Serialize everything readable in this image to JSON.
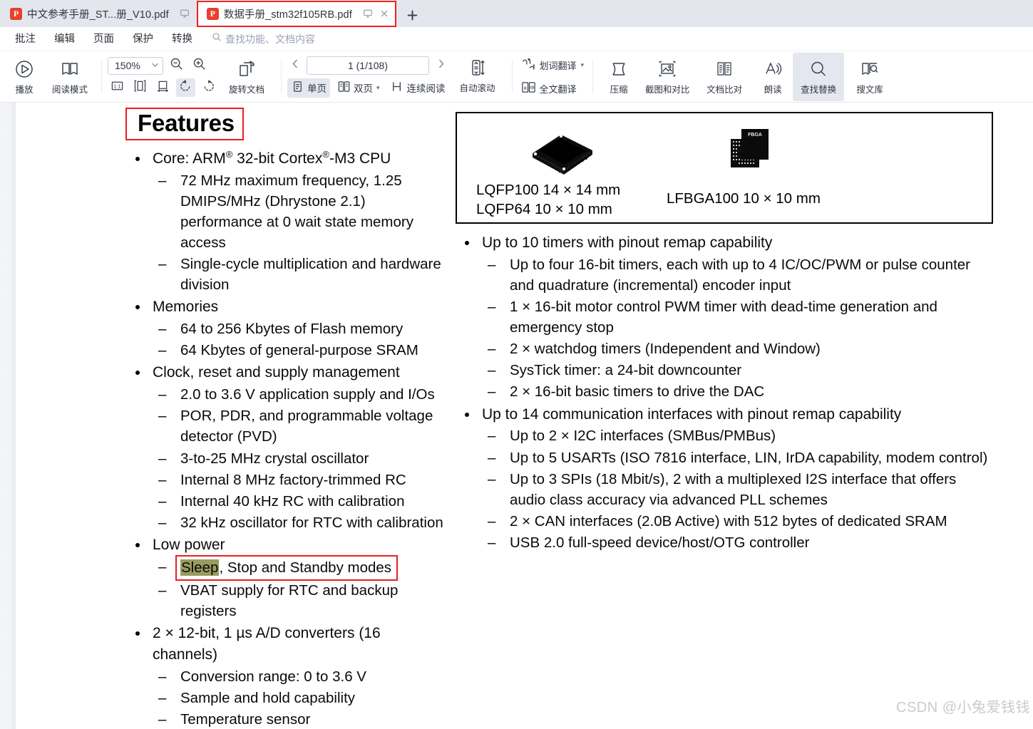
{
  "tabs": [
    {
      "label": "中文参考手册_ST...册_V10.pdf",
      "active": false,
      "badge": "P",
      "has_close": false
    },
    {
      "label": "数据手册_stm32f105RB.pdf",
      "active": true,
      "badge": "P",
      "has_close": true
    }
  ],
  "tabbar": {
    "new_tab_label": "+"
  },
  "menu": {
    "items": [
      "批注",
      "编辑",
      "页面",
      "保护",
      "转换"
    ],
    "search_placeholder": "查找功能、文档内容"
  },
  "toolbar": {
    "play_label": "播放",
    "read_mode_label": "阅读模式",
    "zoom_value": "150%",
    "zoom_out_title": "缩小",
    "zoom_in_title": "放大",
    "fit_actual_label": "1:1",
    "rotate_doc_label": "旋转文档",
    "page_indicator": "1 (1/108)",
    "single_page_label": "单页",
    "double_page_label": "双页",
    "continuous_label": "连续阅读",
    "auto_scroll_label": "自动滚动",
    "word_translate_label": "划词翻译",
    "full_translate_label": "全文翻译",
    "compress_label": "压缩",
    "screenshot_compare_label": "截图和对比",
    "doc_compare_label": "文档比对",
    "read_aloud_label": "朗读",
    "find_replace_label": "查找替换",
    "search_library_label": "搜文库",
    "caret": "▾"
  },
  "document": {
    "heading": "Features",
    "left_column": [
      {
        "text": "Core: ARM® 32-bit Cortex®-M3 CPU",
        "rich": [
          {
            "t": "Core: ARM"
          },
          {
            "t": "®",
            "sup": true
          },
          {
            "t": " 32-bit Cortex"
          },
          {
            "t": "®",
            "sup": true
          },
          {
            "t": "-M3 CPU"
          }
        ],
        "sub": [
          "72 MHz maximum frequency, 1.25 DMIPS/MHz (Dhrystone 2.1) performance at 0 wait state memory access",
          "Single-cycle multiplication and hardware division"
        ]
      },
      {
        "text": "Memories",
        "sub": [
          "64 to 256 Kbytes of Flash memory",
          "64 Kbytes of general-purpose SRAM"
        ]
      },
      {
        "text": "Clock, reset and supply management",
        "sub": [
          "2.0 to 3.6 V application supply and I/Os",
          "POR, PDR, and programmable voltage detector (PVD)",
          "3-to-25 MHz crystal oscillator",
          "Internal 8 MHz factory-trimmed RC",
          "Internal 40 kHz RC with calibration",
          "32 kHz oscillator for RTC with calibration"
        ]
      },
      {
        "text": "Low power",
        "sub": [
          "Sleep, Stop and Standby modes",
          "VBAT supply for RTC and backup registers"
        ],
        "highlighted_sub_index": 0,
        "highlight_word": "Sleep",
        "sub_rest": ", Stop and Standby modes"
      },
      {
        "text": "2 × 12-bit, 1 µs A/D converters (16 channels)",
        "sub": [
          "Conversion range: 0 to 3.6 V",
          "Sample and hold capability",
          "Temperature sensor"
        ]
      }
    ],
    "package_box": {
      "caption_a_line1": "LQFP100 14 × 14 mm",
      "caption_a_line2": "LQFP64 10 × 10 mm",
      "caption_b": "LFBGA100 10 × 10 mm",
      "bga_label": "FBGA"
    },
    "right_column": [
      {
        "text": "Up to 10 timers with pinout remap capability",
        "sub": [
          "Up to four 16-bit timers, each with up to 4 IC/OC/PWM or pulse counter and quadrature (incremental) encoder input",
          "1 × 16-bit motor control PWM timer with dead-time generation and emergency stop",
          "2 × watchdog timers (Independent and Window)",
          "SysTick timer: a 24-bit downcounter",
          "2 × 16-bit basic timers to drive the DAC"
        ]
      },
      {
        "text": "Up to 14 communication interfaces with pinout remap capability",
        "sub": [
          "Up to 2 × I2C interfaces (SMBus/PMBus)",
          "Up to 5 USARTs (ISO 7816 interface, LIN, IrDA capability, modem control)",
          "Up to 3 SPIs (18 Mbit/s), 2 with a multiplexed I2S interface that offers audio class accuracy via advanced PLL schemes",
          "2 × CAN interfaces (2.0B Active) with 512 bytes of dedicated SRAM",
          "USB 2.0 full-speed device/host/OTG controller"
        ]
      }
    ],
    "watermark": "CSDN @小兔爱钱钱"
  },
  "colors": {
    "accent_red": "#ed1c24",
    "pdf_badge": "#e8402a",
    "tab_inactive_bg": "#e3e6ec",
    "highlight_olive": "#9a9b5f",
    "toolbar_selected": "#e4e7ee"
  }
}
